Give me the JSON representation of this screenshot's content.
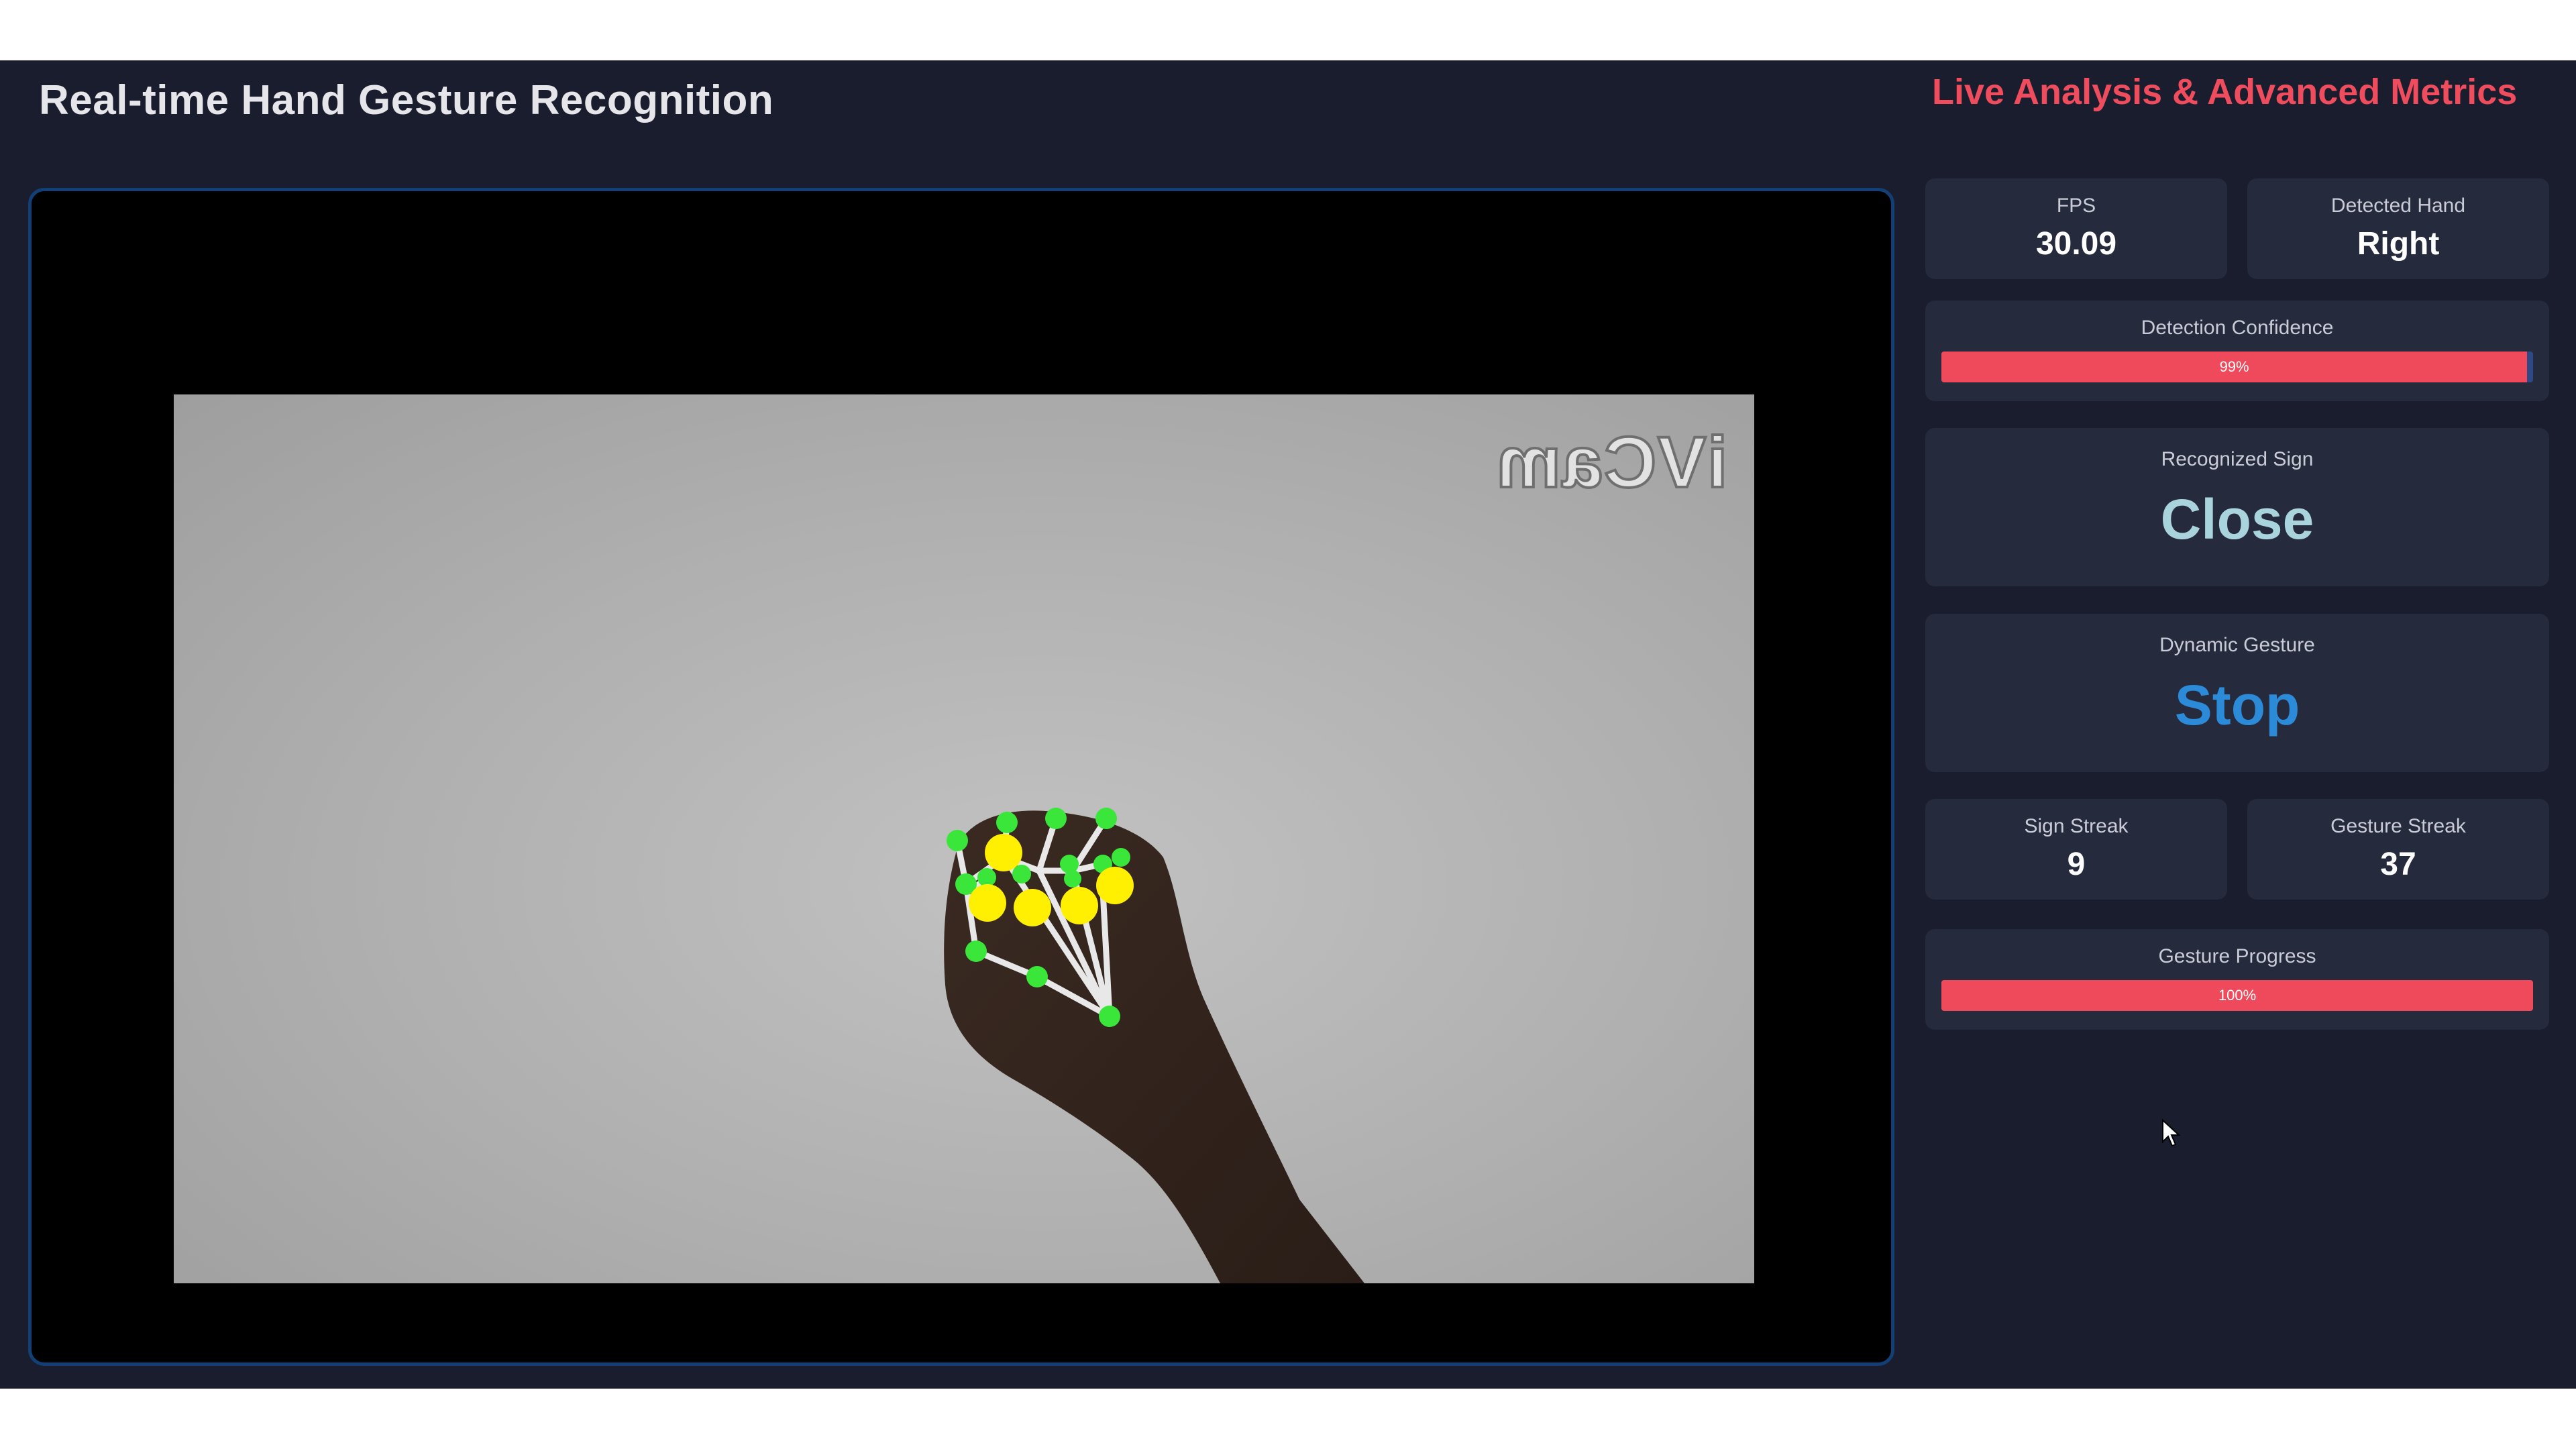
{
  "header": {
    "title": "Real-time Hand Gesture Recognition"
  },
  "video": {
    "watermark": "iVCam",
    "hand_detected": true
  },
  "metrics": {
    "title": "Live Analysis & Advanced Metrics",
    "fps": {
      "label": "FPS",
      "value": "30.09"
    },
    "hand": {
      "label": "Detected Hand",
      "value": "Right"
    },
    "confidence": {
      "label": "Detection Confidence",
      "value": 99,
      "text": "99%"
    },
    "sign": {
      "label": "Recognized Sign",
      "value": "Close"
    },
    "gesture": {
      "label": "Dynamic Gesture",
      "value": "Stop"
    },
    "sign_streak": {
      "label": "Sign Streak",
      "value": "9"
    },
    "gesture_streak": {
      "label": "Gesture Streak",
      "value": "37"
    },
    "progress": {
      "label": "Gesture Progress",
      "value": 100,
      "text": "100%"
    }
  },
  "colors": {
    "background": "#1a1d2e",
    "card": "#262a3d",
    "accent_red": "#ef4d5e",
    "sign_color": "#a9d4de",
    "gesture_color": "#2b8bd8",
    "bar_track": "#2d4a86",
    "landmark_green": "#39e639",
    "landmark_yellow": "#ffef00"
  }
}
